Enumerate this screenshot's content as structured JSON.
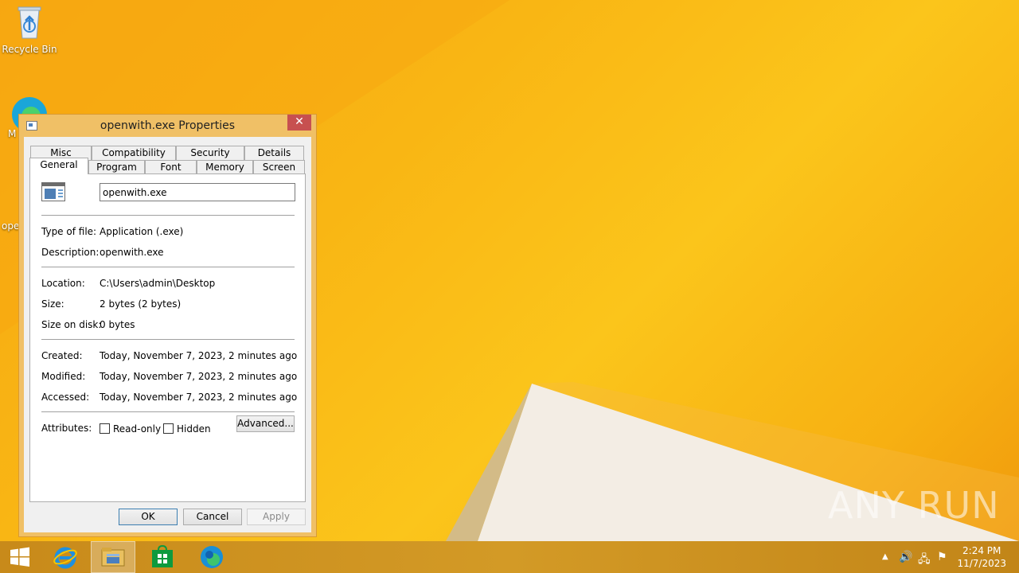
{
  "desktop": {
    "icons": [
      {
        "label": "Recycle Bin"
      },
      {
        "label": "M"
      },
      {
        "label": "ope"
      }
    ],
    "watermark": "ANY RUN"
  },
  "dialog": {
    "title": "openwith.exe Properties",
    "close_label": "✕",
    "tabs_row1": [
      "Misc",
      "Compatibility",
      "Security",
      "Details"
    ],
    "tabs_row2": [
      "General",
      "Program",
      "Font",
      "Memory",
      "Screen"
    ],
    "active_tab": "General",
    "file_name": "openwith.exe",
    "fields": {
      "type_label": "Type of file:",
      "type_value": "Application (.exe)",
      "description_label": "Description:",
      "description_value": "openwith.exe",
      "location_label": "Location:",
      "location_value": "C:\\Users\\admin\\Desktop",
      "size_label": "Size:",
      "size_value": "2 bytes (2 bytes)",
      "size_on_disk_label": "Size on disk:",
      "size_on_disk_value": "0 bytes",
      "created_label": "Created:",
      "created_value": "Today, November 7, 2023, 2 minutes ago",
      "modified_label": "Modified:",
      "modified_value": "Today, November 7, 2023, 2 minutes ago",
      "accessed_label": "Accessed:",
      "accessed_value": "Today, November 7, 2023, 2 minutes ago"
    },
    "attributes": {
      "label": "Attributes:",
      "readonly_label": "Read-only",
      "hidden_label": "Hidden",
      "advanced_label": "Advanced..."
    },
    "buttons": {
      "ok": "OK",
      "cancel": "Cancel",
      "apply": "Apply"
    }
  },
  "taskbar": {
    "items": [
      "start-icon",
      "internet-explorer-icon",
      "file-explorer-icon",
      "store-icon",
      "edge-icon"
    ],
    "active_item": "file-explorer-icon",
    "clock_time": "2:24 PM",
    "clock_date": "11/7/2023"
  },
  "colors": {
    "desktop_orange": "#f9b614",
    "taskbar": "#d39a26",
    "dialog_frame": "#f0c066",
    "close_button": "#c75050"
  }
}
